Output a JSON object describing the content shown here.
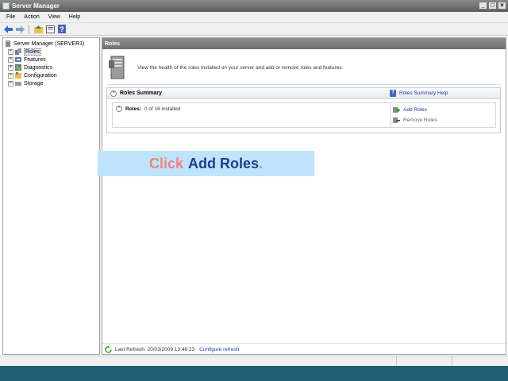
{
  "window": {
    "title": "Server Manager",
    "controls": {
      "minimize": "_",
      "maximize": "□",
      "close": "×"
    }
  },
  "menu": [
    "File",
    "Action",
    "View",
    "Help"
  ],
  "toolbar": {
    "icons": [
      "back-icon",
      "forward-icon",
      "up-icon",
      "properties-icon",
      "help-icon"
    ]
  },
  "tree": {
    "root": "Server Manager (SERVER1)",
    "items": [
      {
        "label": "Roles",
        "icon": "roles-icon",
        "selected": true
      },
      {
        "label": "Features",
        "icon": "features-icon"
      },
      {
        "label": "Diagnostics",
        "icon": "diagnostics-icon"
      },
      {
        "label": "Configuration",
        "icon": "configuration-icon"
      },
      {
        "label": "Storage",
        "icon": "storage-icon"
      }
    ]
  },
  "main": {
    "header": "Roles",
    "intro": "View the health of the roles installed on your server and add or remove roles and features.",
    "summary": {
      "title": "Roles Summary",
      "help_link": "Roles Summary Help",
      "roles_label": "Roles:",
      "roles_count": "0 of 16 installed",
      "actions": {
        "add": "Add Roles",
        "remove": "Remove Roles"
      }
    },
    "status": {
      "last_refresh": "Last Refresh: 20/03/2009 13:48:23",
      "configure": "Configure refresh"
    }
  },
  "callout": {
    "click": "Click",
    "target": "Add Roles",
    "dot": "."
  },
  "colors": {
    "link": "#1a3c9c",
    "callout_bg": "#bfe3f8",
    "taskbar": "#1e5f73"
  }
}
